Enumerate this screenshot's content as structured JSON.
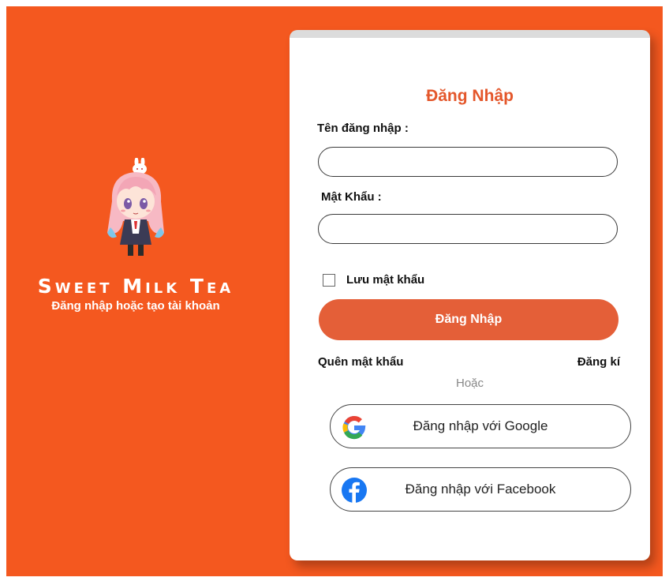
{
  "brand": {
    "title": "Sweet Milk Tea",
    "subtitle": "Đăng nhập hoặc tạo tài khoản"
  },
  "login": {
    "title": "Đăng Nhập",
    "username_label": "Tên đăng nhập :",
    "username_value": "",
    "password_label": "Mật Khẩu :",
    "password_value": "",
    "remember_label": "Lưu mật khẩu",
    "remember_checked": false,
    "submit_label": "Đăng Nhập",
    "forgot_label": "Quên mật khẩu",
    "register_label": "Đăng kí",
    "or_label": "Hoặc",
    "google_label": "Đăng nhập với Google",
    "facebook_label": "Đăng nhập với Facebook"
  },
  "icons": {
    "google": "google-icon",
    "facebook": "facebook-icon",
    "mascot": "anime-girl-mascot"
  },
  "colors": {
    "background": "#f4581f",
    "accent": "#e4572b",
    "button": "#e45f38",
    "facebook": "#1877f2"
  }
}
